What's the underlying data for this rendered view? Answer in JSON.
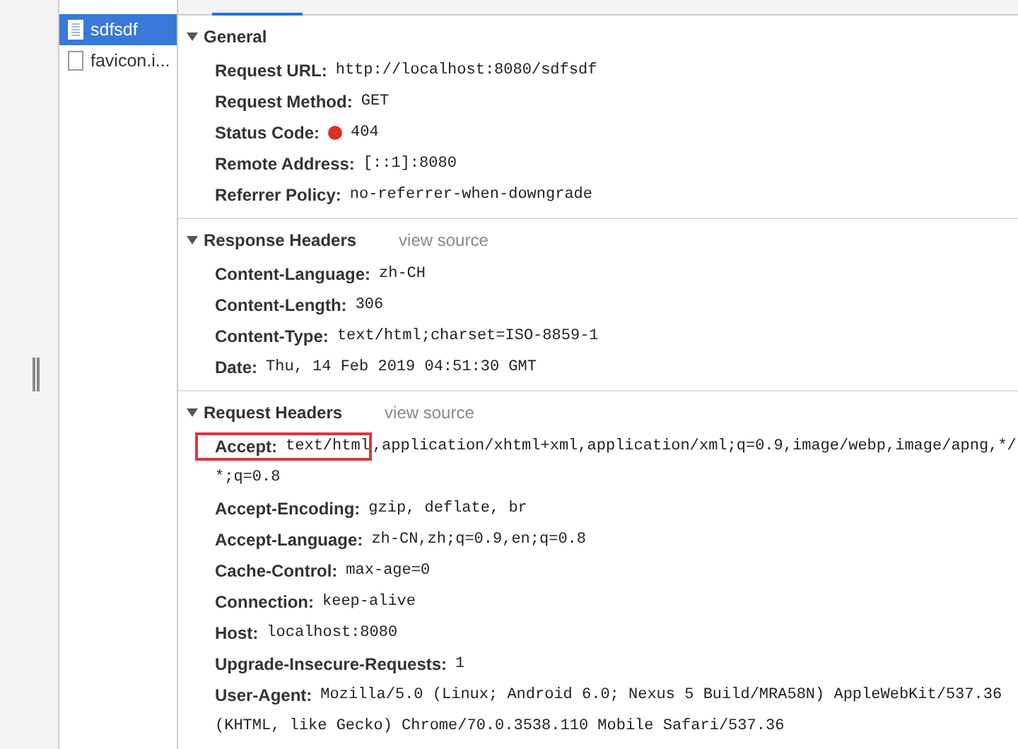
{
  "requests": [
    {
      "name": "sdfsdf",
      "selected": true
    },
    {
      "name": "favicon.i...",
      "selected": false
    }
  ],
  "sections": [
    {
      "title": "General",
      "expanded": true,
      "rows": [
        {
          "name": "Request URL:",
          "value": "http://localhost:8080/sdfsdf",
          "kind": "plain"
        },
        {
          "name": "Request Method:",
          "value": "GET",
          "kind": "plain"
        },
        {
          "name": "Status Code:",
          "value": "404",
          "kind": "status"
        },
        {
          "name": "Remote Address:",
          "value": "[::1]:8080",
          "kind": "plain"
        },
        {
          "name": "Referrer Policy:",
          "value": "no-referrer-when-downgrade",
          "kind": "plain"
        }
      ]
    },
    {
      "title": "Response Headers",
      "expanded": true,
      "link": "view source",
      "rows": [
        {
          "name": "Content-Language:",
          "value": "zh-CH",
          "kind": "plain"
        },
        {
          "name": "Content-Length:",
          "value": "306",
          "kind": "plain"
        },
        {
          "name": "Content-Type:",
          "value": "text/html;charset=ISO-8859-1",
          "kind": "plain"
        },
        {
          "name": "Date:",
          "value": "Thu, 14 Feb 2019 04:51:30 GMT",
          "kind": "plain"
        }
      ]
    },
    {
      "title": "Request Headers",
      "expanded": true,
      "link": "view source",
      "rows": [
        {
          "name": "Accept:",
          "highlighted_value": "text/html",
          "value": ",application/xhtml+xml,application/xml;q=0.9,image/webp,image/apng,*/",
          "continuation": "*;q=0.8",
          "kind": "highlighted"
        },
        {
          "name": "Accept-Encoding:",
          "value": "gzip, deflate, br",
          "kind": "plain"
        },
        {
          "name": "Accept-Language:",
          "value": "zh-CN,zh;q=0.9,en;q=0.8",
          "kind": "plain"
        },
        {
          "name": "Cache-Control:",
          "value": "max-age=0",
          "kind": "plain"
        },
        {
          "name": "Connection:",
          "value": "keep-alive",
          "kind": "plain"
        },
        {
          "name": "Host:",
          "value": "localhost:8080",
          "kind": "plain"
        },
        {
          "name": "Upgrade-Insecure-Requests:",
          "value": "1",
          "kind": "plain"
        },
        {
          "name": "User-Agent:",
          "value": "Mozilla/5.0 (Linux; Android 6.0; Nexus 5 Build/MRA58N) AppleWebKit/537.36",
          "continuation": "(KHTML, like Gecko) Chrome/70.0.3538.110 Mobile Safari/537.36",
          "kind": "plain"
        }
      ]
    }
  ]
}
